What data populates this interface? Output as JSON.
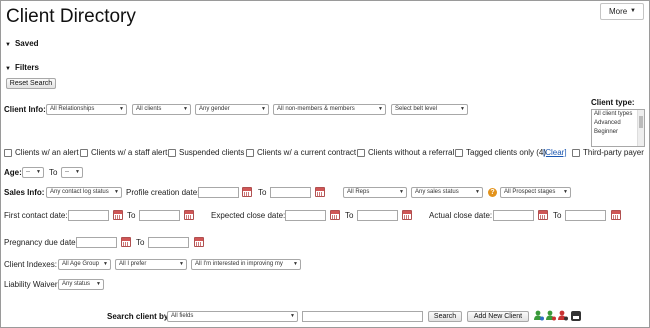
{
  "page": {
    "title": "Client Directory",
    "more_label": "More",
    "saved_label": "Saved",
    "filters_label": "Filters",
    "reset_label": "Reset Search"
  },
  "client_info": {
    "label": "Client Info:",
    "relationships": "All Relationships",
    "clients": "All clients",
    "gender": "Any gender",
    "membership": "All non-members & members",
    "belt": "Select belt level"
  },
  "client_type": {
    "label": "Client type:",
    "options": [
      "All client types",
      "Advanced",
      "Beginner"
    ]
  },
  "checkboxes": {
    "alert": "Clients w/ an alert",
    "staff_alert": "Clients w/ a staff alert",
    "suspended": "Suspended clients",
    "contract": "Clients w/ a current contract",
    "no_referral": "Clients without a referral",
    "tagged": "Tagged clients only (4)",
    "clear": "[Clear]",
    "third_party": "Third-party payer"
  },
  "age": {
    "label": "Age:",
    "from": "--",
    "to_label": "To",
    "to": "--"
  },
  "sales": {
    "label": "Sales Info:",
    "contact_log": "Any contact log status",
    "profile_label": "Profile creation date:",
    "to_label": "To",
    "reps": "All Reps",
    "sales_status": "Any sales status",
    "prospect": "All Prospect stages",
    "help": "?"
  },
  "dates": {
    "first_contact": "First contact date:",
    "expected_close": "Expected close date:",
    "actual_close": "Actual close date:",
    "pregnancy_due": "Pregnancy due date:",
    "to_label": "To"
  },
  "indexes": {
    "label": "Client Indexes:",
    "age_group": "All Age Group",
    "prefer": "All I prefer",
    "improving": "All I'm interested in improving my"
  },
  "waiver": {
    "label": "Liability Waiver:",
    "status": "Any status"
  },
  "search": {
    "label": "Search client by",
    "field": "All fields",
    "value": "",
    "search_btn": "Search",
    "add_btn": "Add New Client"
  },
  "colors": {
    "calendar": "#d05656",
    "help": "#e3931b",
    "link": "#1a56b0",
    "person_green": "#3a9a3a",
    "person_red": "#c83232"
  }
}
